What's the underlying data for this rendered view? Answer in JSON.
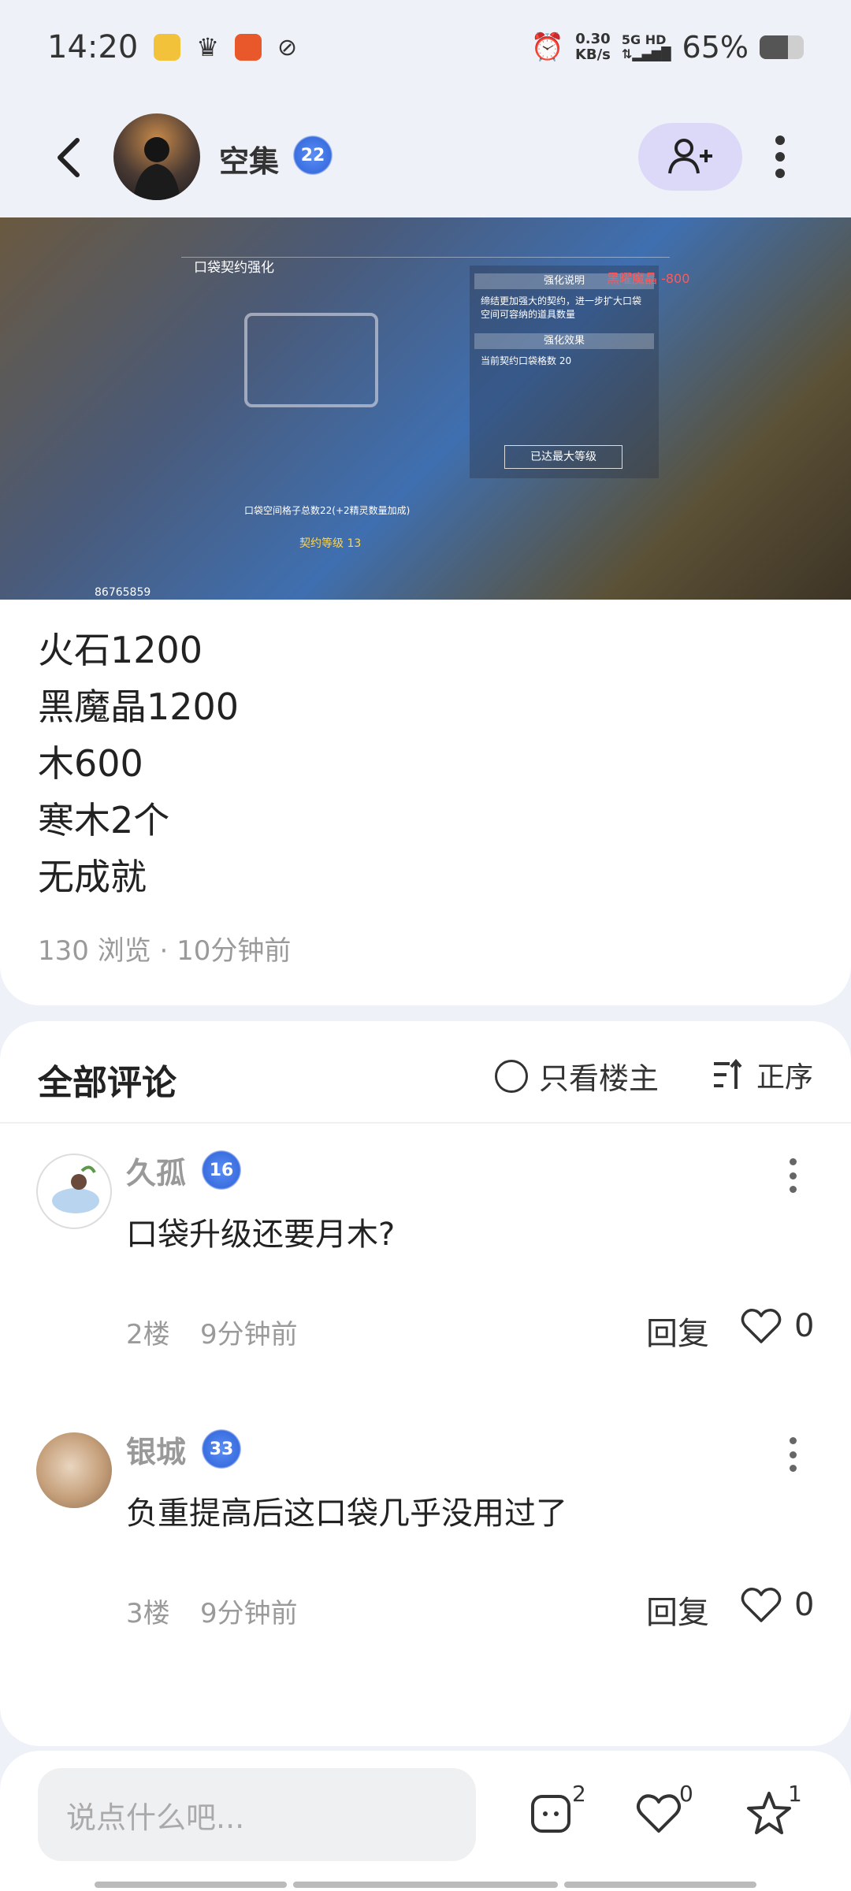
{
  "status": {
    "time": "14:20",
    "net_speed_value": "0.30",
    "net_speed_unit": "KB/s",
    "network": "5G HD",
    "battery": "65%",
    "battery_level": 0.65
  },
  "header": {
    "author": "空集",
    "level": "22"
  },
  "post_image": {
    "panel_title": "口袋契约强化",
    "side_heading_1": "强化说明",
    "side_text": "缔结更加强大的契约，进一步扩大口袋空间可容纳的道具数量",
    "side_heading_2": "强化效果",
    "side_effect": "当前契约口袋格数  20",
    "max_button": "已达最大等级",
    "capacity": "口袋空间格子总数22(+2精灵数量加成)",
    "contract_level": "契约等级 13",
    "resource": "黑曜魔晶 -800",
    "image_id": "86765859"
  },
  "post": {
    "lines": [
      "火石1200",
      "黑魔晶1200",
      "木600",
      "寒木2个",
      "无成就"
    ],
    "meta": "130 浏览 · 10分钟前"
  },
  "comments_section": {
    "title": "全部评论",
    "only_host": "只看楼主",
    "sort": "正序"
  },
  "comments": [
    {
      "name": "久孤",
      "level": "16",
      "text": "口袋升级还要月木?",
      "floor": "2楼",
      "time": "9分钟前",
      "reply": "回复",
      "likes": "0"
    },
    {
      "name": "银城",
      "level": "33",
      "text": "负重提高后这口袋几乎没用过了",
      "floor": "3楼",
      "time": "9分钟前",
      "reply": "回复",
      "likes": "0"
    }
  ],
  "bottom": {
    "placeholder": "说点什么吧...",
    "comment_count": "2",
    "like_count": "0",
    "fav_count": "1"
  }
}
